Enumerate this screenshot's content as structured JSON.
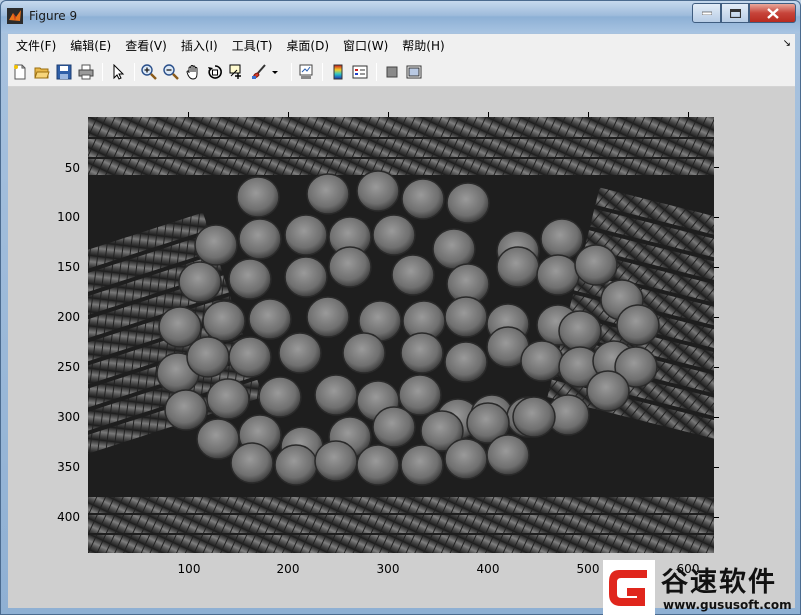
{
  "window": {
    "title": "Figure 9"
  },
  "menu": {
    "items": [
      {
        "label": "文件(F)"
      },
      {
        "label": "编辑(E)"
      },
      {
        "label": "查看(V)"
      },
      {
        "label": "插入(I)"
      },
      {
        "label": "工具(T)"
      },
      {
        "label": "桌面(D)"
      },
      {
        "label": "窗口(W)"
      },
      {
        "label": "帮助(H)"
      }
    ]
  },
  "toolbar": {
    "icons": [
      "new-figure-icon",
      "open-file-icon",
      "save-icon",
      "print-icon",
      "edit-plot-arrow-icon",
      "zoom-in-icon",
      "zoom-out-icon",
      "pan-hand-icon",
      "rotate-3d-icon",
      "data-cursor-icon",
      "brush-icon",
      "brush-dropdown-icon",
      "link-plot-icon",
      "colorbar-icon",
      "legend-icon",
      "hide-plot-tools-icon",
      "show-plot-tools-icon"
    ]
  },
  "axes": {
    "x_ticks": [
      "100",
      "200",
      "300",
      "400",
      "500",
      "600"
    ],
    "y_ticks": [
      "50",
      "100",
      "150",
      "200",
      "250",
      "300",
      "350",
      "400"
    ],
    "image_description_colors": {
      "background": "#1d1d1d",
      "figure_bg": "#cfcfcf"
    }
  },
  "watermark": {
    "name": "谷速软件",
    "url": "www.gususoft.com",
    "accent": "#e0261c"
  }
}
